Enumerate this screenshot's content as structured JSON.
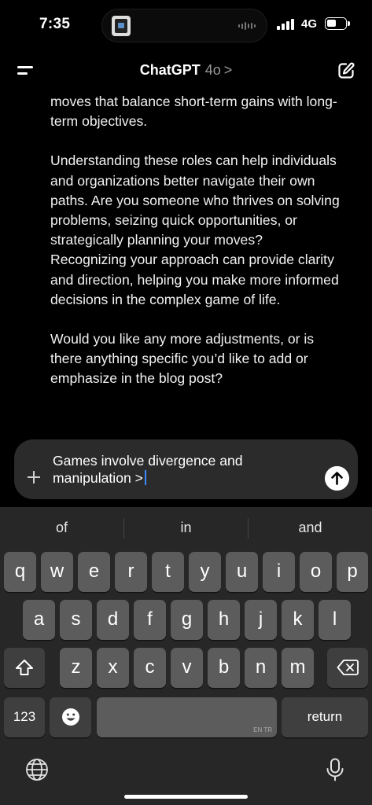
{
  "status_bar": {
    "time": "7:35",
    "network": "4G"
  },
  "header": {
    "title": "ChatGPT",
    "model": "4o",
    "chevron": ">"
  },
  "messages": [
    "moves that balance short-term gains with long-term objectives.",
    "Understanding these roles can help individuals and organizations better navigate their own paths. Are you someone who thrives on solving problems, seizing quick opportunities, or strategically planning your moves? Recognizing your approach can provide clarity and direction, helping you make more informed decisions in the complex game of life.",
    "Would you like any more adjustments, or is there anything specific you’d like to add or emphasize in the blog post?"
  ],
  "composer": {
    "line1": "Games involve divergence and",
    "line2": "manipulation >"
  },
  "keyboard": {
    "suggestions": [
      "of",
      "in",
      "and"
    ],
    "row1": [
      "q",
      "w",
      "e",
      "r",
      "t",
      "y",
      "u",
      "i",
      "o",
      "p"
    ],
    "row2": [
      "a",
      "s",
      "d",
      "f",
      "g",
      "h",
      "j",
      "k",
      "l"
    ],
    "row3": [
      "z",
      "x",
      "c",
      "v",
      "b",
      "n",
      "m"
    ],
    "numbers_label": "123",
    "return_label": "return",
    "space_lang": "EN TR"
  },
  "icons": {
    "menu": "menu-icon",
    "edit": "new-chat-icon",
    "plus": "plus-icon",
    "send": "send-arrow-icon",
    "shift": "shift-icon",
    "backspace": "backspace-icon",
    "emoji": "emoji-icon",
    "globe": "globe-icon",
    "mic": "mic-icon"
  }
}
